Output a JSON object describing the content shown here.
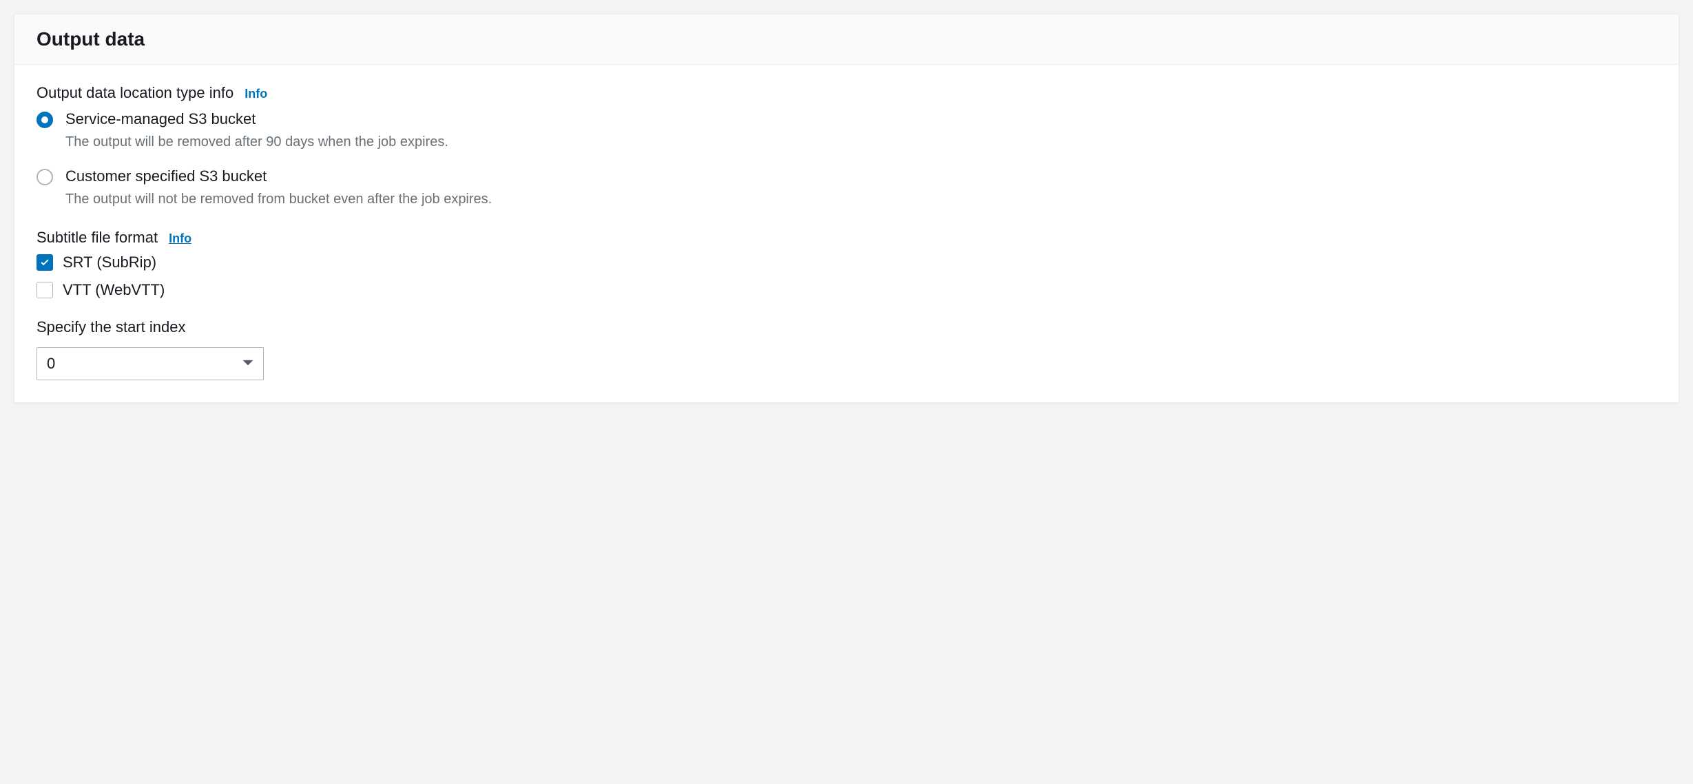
{
  "panel": {
    "title": "Output data"
  },
  "location": {
    "label": "Output data location type info",
    "info_label": "Info",
    "options": [
      {
        "title": "Service-managed S3 bucket",
        "desc": "The output will be removed after 90 days when the job expires.",
        "checked": true
      },
      {
        "title": "Customer specified S3 bucket",
        "desc": "The output will not be removed from bucket even after the job expires.",
        "checked": false
      }
    ]
  },
  "subtitle": {
    "label": "Subtitle file format",
    "info_label": "Info",
    "options": [
      {
        "label": "SRT (SubRip)",
        "checked": true
      },
      {
        "label": "VTT (WebVTT)",
        "checked": false
      }
    ]
  },
  "start_index": {
    "label": "Specify the start index",
    "value": "0"
  }
}
